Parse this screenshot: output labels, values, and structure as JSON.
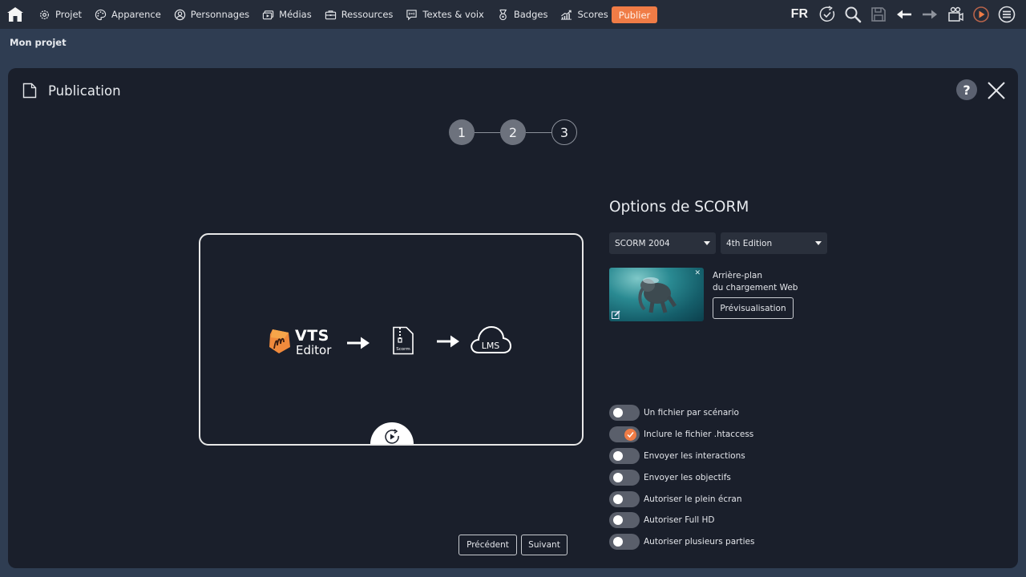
{
  "topbar": {
    "home_icon": "home-icon",
    "nav": [
      {
        "label": "Projet",
        "icon": "gear-icon"
      },
      {
        "label": "Apparence",
        "icon": "palette-icon"
      },
      {
        "label": "Personnages",
        "icon": "person-circle-icon"
      },
      {
        "label": "Médias",
        "icon": "media-icon"
      },
      {
        "label": "Ressources",
        "icon": "briefcase-icon"
      },
      {
        "label": "Textes & voix",
        "icon": "speech-bubble-icon"
      },
      {
        "label": "Badges",
        "icon": "medal-icon"
      },
      {
        "label": "Scores",
        "icon": "chart-icon"
      }
    ],
    "publish_label": "Publier",
    "language": "FR",
    "tools": [
      "check-cycle-icon",
      "search-icon",
      "save-icon",
      "undo-arrow-icon",
      "redo-arrow-icon",
      "camera-icon",
      "play-icon",
      "menu-icon"
    ],
    "accent_color": "#f07c46"
  },
  "project": {
    "name": "Mon projet"
  },
  "panel": {
    "title": "Publication",
    "help_label": "?",
    "stepper": {
      "steps": [
        "1",
        "2",
        "3"
      ],
      "current_step": 2
    },
    "preview": {
      "logo_title": "VTS",
      "logo_subtitle": "Editor",
      "file_label": "Scorm",
      "destination_label": "LMS"
    },
    "options": {
      "title": "Options de SCORM",
      "scorm_version": "SCORM 2004",
      "edition": "4th Edition",
      "background_label_line1": "Arrière-plan",
      "background_label_line2": "du chargement Web",
      "preview_button": "Prévisualisation",
      "toggles": [
        {
          "label": "Un fichier par scénario",
          "on": false
        },
        {
          "label": "Inclure le fichier .htaccess",
          "on": true
        },
        {
          "label": "Envoyer les interactions",
          "on": false
        },
        {
          "label": "Envoyer les objectifs",
          "on": false
        },
        {
          "label": "Autoriser le plein écran",
          "on": false
        },
        {
          "label": "Autoriser Full HD",
          "on": false
        },
        {
          "label": "Autoriser plusieurs parties",
          "on": false
        }
      ]
    },
    "footer": {
      "previous_label": "Précédent",
      "next_label": "Suivant"
    }
  }
}
